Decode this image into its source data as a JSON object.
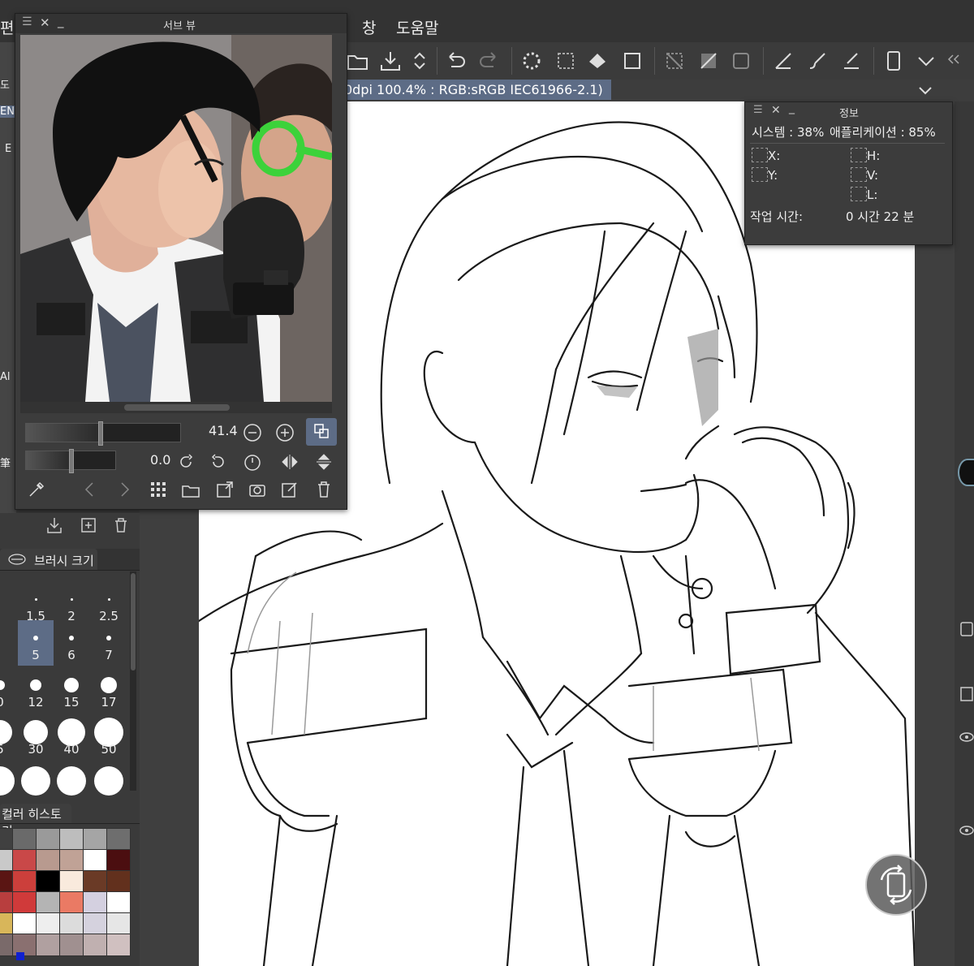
{
  "menubar": {
    "left_partial": "편",
    "items": [
      "창",
      "도움말"
    ]
  },
  "status": {
    "text": "0dpi 100.4% : RGB:sRGB IEC61966-2.1)"
  },
  "subview": {
    "title": "서브 뷰",
    "zoom_value": "41.4",
    "rotation_value": "0.0"
  },
  "brush_size": {
    "tab_label": "브러시 크기",
    "sizes": [
      "1.5",
      "2",
      "2.5",
      "5",
      "6",
      "7",
      "0",
      "12",
      "15",
      "17",
      "5",
      "30",
      "40",
      "50"
    ],
    "selected": "5"
  },
  "left_strip": {
    "labels": [
      "도",
      "EN",
      "E",
      "Al",
      "筆"
    ]
  },
  "color_history": {
    "tab_label": "컬러 히스토리",
    "colors": [
      "#404040",
      "#6a6a6a",
      "#9a9a9a",
      "#bdbdbd",
      "#a5a5a5",
      "#6e6e6e",
      "#c9c9c9",
      "#c94848",
      "#b89a8f",
      "#c0a296",
      "#ffffff",
      "#4b0e10",
      "#5a1513",
      "#cc3f3b",
      "#000000",
      "#f9eadd",
      "#6a3a26",
      "#62301d",
      "#b83e3e",
      "#d03a3a",
      "#b4b4b4",
      "#ea7a64",
      "#d4d0e0",
      "#ffffff",
      "#d8b65a",
      "#ffffff",
      "#eeeeee",
      "#dcdcdc",
      "#d5d2de",
      "#e6e6e6",
      "#7a6a6a",
      "#8a7070",
      "#b0a0a0",
      "#a09090",
      "#c0b0b0",
      "#d0c0c0"
    ]
  },
  "info": {
    "title": "정보",
    "system": "시스템 : 38%",
    "app": "애플리케이션 : 85%",
    "x": "X:",
    "y": "Y:",
    "h": "H:",
    "v": "V:",
    "l": "L:",
    "work_time_label": "작업 시간:",
    "work_time_value": "0 시간 22 분"
  }
}
